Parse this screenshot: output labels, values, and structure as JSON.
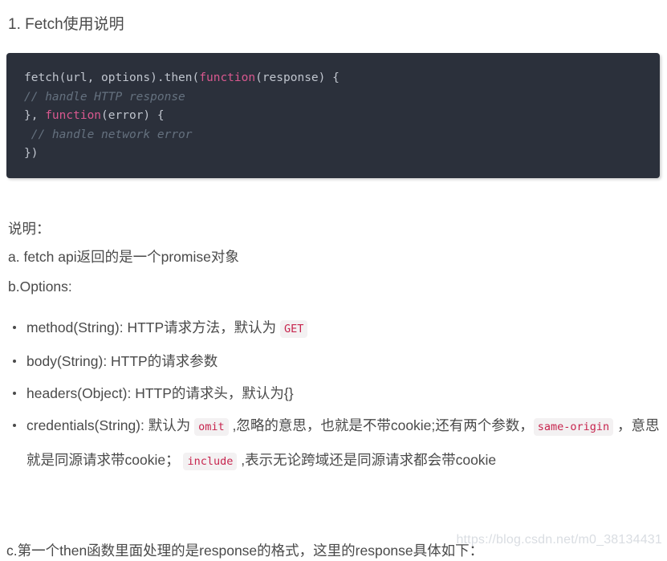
{
  "document": {
    "title": "1. Fetch使用说明",
    "watermark": "https://blog.csdn.net/m0_38134431"
  },
  "code_block": {
    "language": "javascript",
    "background_color": "#2b303b",
    "lines": [
      {
        "parts": [
          {
            "text": "fetch(url, options).then(",
            "type": "plain"
          },
          {
            "text": "function",
            "type": "keyword"
          },
          {
            "text": "(response) {",
            "type": "plain"
          }
        ]
      },
      {
        "parts": [
          {
            "text": "// handle HTTP response",
            "type": "comment"
          }
        ]
      },
      {
        "parts": [
          {
            "text": "}, ",
            "type": "plain"
          },
          {
            "text": "function",
            "type": "keyword"
          },
          {
            "text": "(error) {",
            "type": "plain"
          }
        ]
      },
      {
        "parts": [
          {
            "text": " // handle network error",
            "type": "comment"
          }
        ]
      },
      {
        "parts": [
          {
            "text": "})",
            "type": "plain"
          }
        ]
      }
    ],
    "flat_text": "fetch(url, options).then(function(response) {\n// handle HTTP response\n}, function(error) {\n // handle network error\n})"
  },
  "notes": {
    "heading": "说明：",
    "item_a": "a. fetch api返回的是一个promise对象",
    "item_b": "b.Options:",
    "item_c": "c.第一个then函数里面处理的是response的格式，这里的response具体如下："
  },
  "options_list": [
    {
      "segments": [
        {
          "text": "method(String): HTTP请求方法，默认为 ",
          "type": "text"
        },
        {
          "text": "GET",
          "type": "code"
        }
      ]
    },
    {
      "segments": [
        {
          "text": "body(String): HTTP的请求参数",
          "type": "text"
        }
      ]
    },
    {
      "segments": [
        {
          "text": "headers(Object): HTTP的请求头，默认为{}",
          "type": "text"
        }
      ]
    },
    {
      "segments": [
        {
          "text": "credentials(String): 默认为 ",
          "type": "text"
        },
        {
          "text": "omit",
          "type": "code"
        },
        {
          "text": " ,忽略的意思，也就是不带cookie;还有两个参数，",
          "type": "text"
        },
        {
          "text": "same-origin",
          "type": "code"
        },
        {
          "text": " ，意思就是同源请求带cookie； ",
          "type": "text"
        },
        {
          "text": "include",
          "type": "code"
        },
        {
          "text": " ,表示无论跨域还是同源请求都会带cookie",
          "type": "text"
        }
      ]
    }
  ],
  "colors": {
    "text": "#4a4a4a",
    "code_background": "#2b303b",
    "code_plain": "#c0c5ce",
    "code_keyword": "#d9588f",
    "code_comment": "#65717f",
    "inline_code_text": "#c7254e",
    "inline_code_background": "#f3f1f2",
    "watermark": "#d9dde2"
  }
}
